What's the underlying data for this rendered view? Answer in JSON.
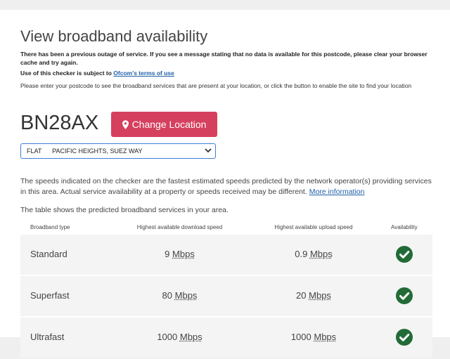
{
  "header": {
    "title": "View broadband availability"
  },
  "notices": {
    "outage": "There has been a previous outage of service. If you see a message stating that no data is available for this postcode, please clear your browser cache and try again.",
    "terms_prefix": "Use of this checker is subject to",
    "terms_link": "Ofcom's terms of use",
    "instructions": "Please enter your postcode to see the broadband services that are present at your location, or click the button to enable the site to find your location"
  },
  "location": {
    "postcode": "BN28AX",
    "change_button": "Change Location",
    "address_selected": "FLAT      PACIFIC HEIGHTS, SUEZ WAY"
  },
  "info": {
    "speeds_text": "The speeds indicated on the checker are the fastest estimated speeds predicted by the network operator(s) providing services in this area. Actual service availability at a property or speeds received may be different.",
    "more_info_link": "More information",
    "table_intro": "The table shows the predicted broadband services in your area."
  },
  "table": {
    "headers": [
      "Broadband type",
      "Highest available download speed",
      "Highest available upload speed",
      "Availability"
    ],
    "unit": "Mbps",
    "rows": [
      {
        "type": "Standard",
        "download": "9",
        "upload": "0.9",
        "available": true
      },
      {
        "type": "Superfast",
        "download": "80",
        "upload": "20",
        "available": true
      },
      {
        "type": "Ultrafast",
        "download": "1000",
        "upload": "1000",
        "available": true
      }
    ]
  },
  "colors": {
    "accent_button": "#d6405f",
    "link": "#1f5fa8",
    "check_green": "#226b37",
    "select_border": "#3d7dd8"
  },
  "icons": {
    "location": "map-marker-icon",
    "dropdown": "chevron-down-icon",
    "availability": "check-circle-icon"
  }
}
